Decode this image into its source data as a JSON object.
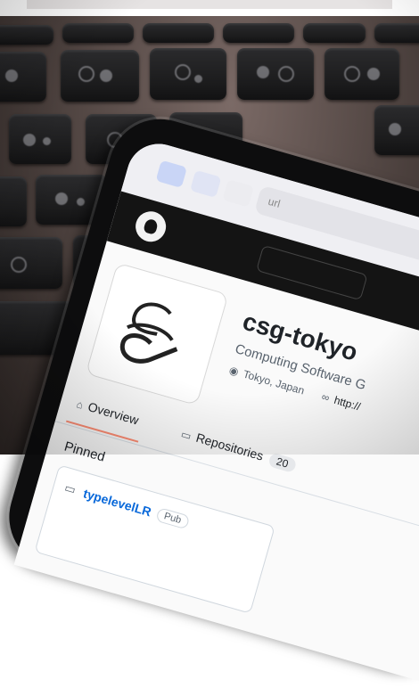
{
  "browser": {
    "url_hint": "url"
  },
  "org": {
    "name": "csg-tokyo",
    "description": "Computing Software G",
    "location": "Tokyo, Japan",
    "link": "http://"
  },
  "nav": {
    "overview_label": "Overview",
    "repositories_label": "Repositories",
    "repositories_count": "20"
  },
  "pinned": {
    "title": "Pinned",
    "repo_name": "typelevelLR",
    "visibility": "Pub"
  },
  "icons": [
    "home-icon",
    "repo-icon",
    "location-icon",
    "link-icon",
    "github-logo-icon"
  ],
  "colors": {
    "accent_underline": "#fd8c73",
    "link_blue": "#0969da",
    "header_dark": "#141414"
  }
}
